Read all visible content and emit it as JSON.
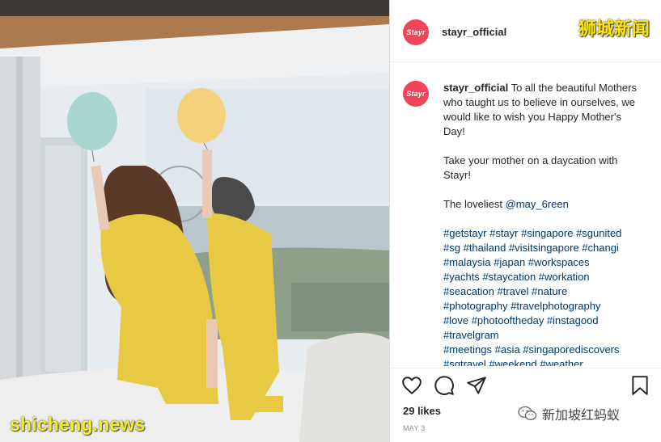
{
  "post": {
    "username": "stayr_official",
    "avatar_text": "Stayr",
    "caption_user": "stayr_official",
    "caption_lead": " To all the beautiful Mothers who taught us to believe in ourselves, we would like to wish you Happy Mother's Day!",
    "caption_p2": "Take your mother on a daycation with Stayr!",
    "caption_p3_prefix": "The loveliest ",
    "caption_p3_mention": "@may_6reen",
    "hashtag_lines": [
      "#getstayr #stayr #singapore #sgunited",
      "#sg #thailand #visitsingapore #changi",
      "#malaysia #japan #workspaces",
      "#yachts #staycation #workation",
      "#seacation #travel #nature",
      "#photography #travelphotography",
      "#love #photooftheday #instagood",
      "#travelgram",
      "#meetings #asia #singaporediscovers",
      "#sgtravel #weekend #weather"
    ],
    "likes": "29 likes",
    "date": "MAY 3"
  },
  "icons": {
    "like": "heart-icon",
    "comment": "comment-icon",
    "share": "share-icon",
    "save": "bookmark-icon"
  },
  "watermarks": {
    "top_right": "狮城新闻",
    "bottom_left": "shicheng.news",
    "wechat": "新加坡红蚂蚁"
  },
  "colors": {
    "avatar": "#f0445a",
    "link": "#00376b",
    "watermark_yellow": "#ffe600"
  }
}
